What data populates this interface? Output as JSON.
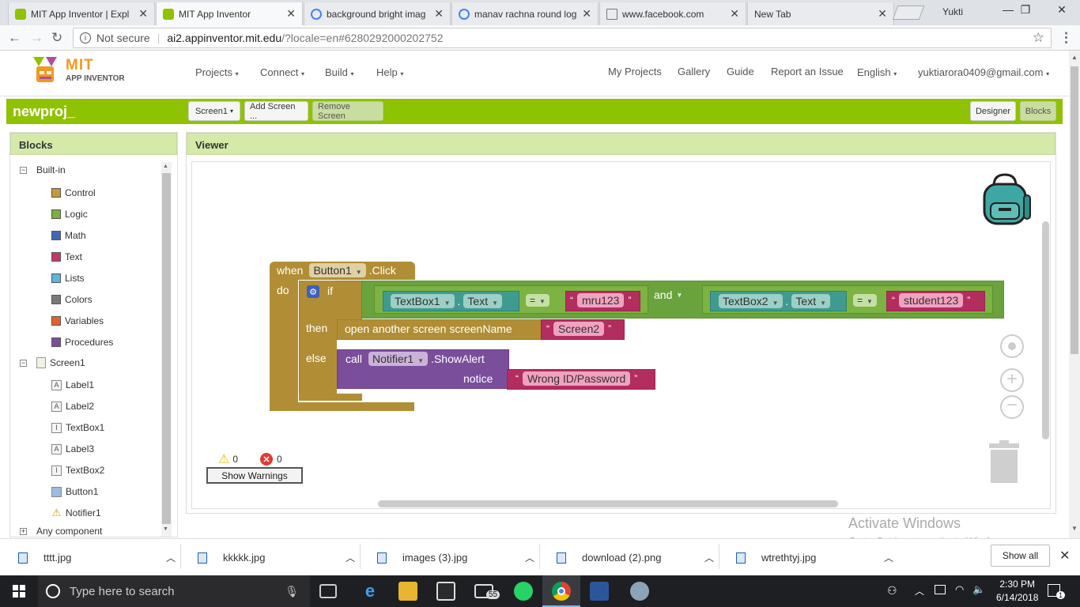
{
  "browser": {
    "tabs": [
      {
        "title": "MIT App Inventor | Expl",
        "active": false
      },
      {
        "title": "MIT App Inventor",
        "active": true
      },
      {
        "title": "background bright imag",
        "active": false
      },
      {
        "title": "manav rachna round log",
        "active": false
      },
      {
        "title": "www.facebook.com",
        "active": false
      },
      {
        "title": "New Tab",
        "active": false
      }
    ],
    "profile_name": "Yukti",
    "security_label": "Not secure",
    "url_host": "ai2.appinventor.mit.edu",
    "url_rest": "/?locale=en#6280292000202752"
  },
  "app": {
    "logo_top": "MIT",
    "logo_bottom": "APP INVENTOR",
    "menus": [
      "Projects",
      "Connect",
      "Build",
      "Help"
    ],
    "right_links": [
      "My Projects",
      "Gallery",
      "Guide",
      "Report an Issue"
    ],
    "language": "English",
    "user_email": "yuktiarora0409@gmail.com",
    "project_name": "newproj_",
    "screen_select": "Screen1",
    "add_screen_label": "Add Screen ...",
    "remove_screen_label": "Remove Screen",
    "designer_label": "Designer",
    "blocks_label": "Blocks"
  },
  "blocks_panel": {
    "title": "Blocks",
    "builtin_label": "Built-in",
    "builtin": [
      {
        "label": "Control",
        "color": "#c49a3a"
      },
      {
        "label": "Logic",
        "color": "#7bb03c"
      },
      {
        "label": "Math",
        "color": "#3f68b6"
      },
      {
        "label": "Text",
        "color": "#c13866"
      },
      {
        "label": "Lists",
        "color": "#59b6e0"
      },
      {
        "label": "Colors",
        "color": "#7a7a7a"
      },
      {
        "label": "Variables",
        "color": "#e0652a"
      },
      {
        "label": "Procedures",
        "color": "#7b4e9c"
      }
    ],
    "screen_label": "Screen1",
    "components": [
      {
        "label": "Label1",
        "icon": "A"
      },
      {
        "label": "Label2",
        "icon": "A"
      },
      {
        "label": "TextBox1",
        "icon": "I"
      },
      {
        "label": "Label3",
        "icon": "A"
      },
      {
        "label": "TextBox2",
        "icon": "I"
      },
      {
        "label": "Button1",
        "icon": "B"
      },
      {
        "label": "Notifier1",
        "icon": "!"
      }
    ],
    "any_component_label": "Any component"
  },
  "viewer": {
    "title": "Viewer",
    "warnings_count": "0",
    "errors_count": "0",
    "show_warnings_label": "Show Warnings"
  },
  "code": {
    "when": "when",
    "button": "Button1",
    "click": ".Click",
    "do": "do",
    "if": "if",
    "then": "then",
    "else": "else",
    "textbox1": "TextBox1",
    "textbox2": "TextBox2",
    "text_prop": "Text",
    "dot": ".",
    "eq": "=",
    "and": "and",
    "str1": "mru123",
    "str2": "student123",
    "open_screen": "open another screen  screenName",
    "screen2": "Screen2",
    "call": "call",
    "notifier": "Notifier1",
    "show_alert": ".ShowAlert",
    "notice": "notice",
    "msg": "Wrong ID/Password",
    "quote_open": "“",
    "quote_close": "”"
  },
  "activate": {
    "line1": "Activate Windows",
    "line2": "Go to Settings to activate Windows."
  },
  "downloads": {
    "items": [
      "tttt.jpg",
      "kkkkk.jpg",
      "images (3).jpg",
      "download (2).png",
      "wtrethtyj.jpg"
    ],
    "show_all": "Show all"
  },
  "taskbar": {
    "search_placeholder": "Type here to search",
    "mail_badge": "55",
    "time": "2:30 PM",
    "date": "6/14/2018",
    "notif_count": "1"
  }
}
